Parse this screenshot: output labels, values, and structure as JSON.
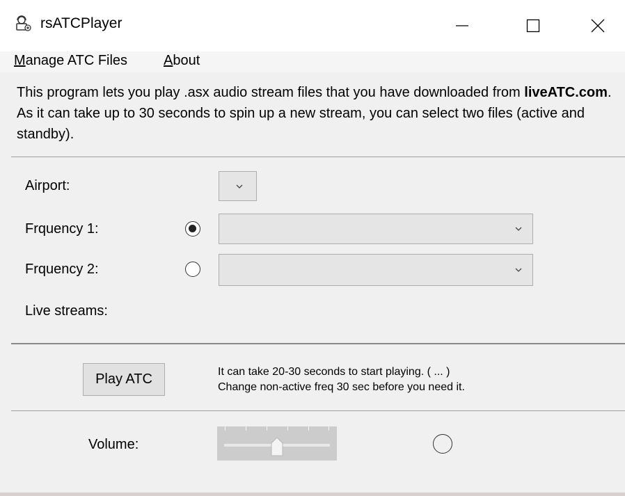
{
  "window": {
    "title": "rsATCPlayer",
    "controls": {
      "minimize": "minimize-icon",
      "maximize": "maximize-icon",
      "close": "close-icon"
    }
  },
  "menu": {
    "manage": {
      "accel": "M",
      "rest": "anage ATC Files"
    },
    "about": {
      "accel": "A",
      "rest": "bout"
    }
  },
  "description": {
    "part1": "This program lets you play .asx audio stream files that you have downloaded from ",
    "bold": "liveATC.com",
    "part2": ". As it can take up to 30 seconds to spin up a new stream, you can select two files (active and standby)."
  },
  "form": {
    "airport_label": "Airport:",
    "airport_value": "",
    "freq1_label": "Frquency 1:",
    "freq1_value": "",
    "freq1_selected": true,
    "freq2_label": "Frquency 2:",
    "freq2_value": "",
    "freq2_selected": false,
    "live_streams_label": "Live streams:"
  },
  "play": {
    "button_label": "Play ATC",
    "info_line1": "It can take 20-30 seconds to start playing. ( ... )",
    "info_line2": "Change non-active freq 30 sec before you need it."
  },
  "volume": {
    "label": "Volume:",
    "level": 0.5
  },
  "colors": {
    "window_bg": "#f0f0f0",
    "titlebar_bg": "#ffffff",
    "slider_bg": "#cccccc"
  }
}
